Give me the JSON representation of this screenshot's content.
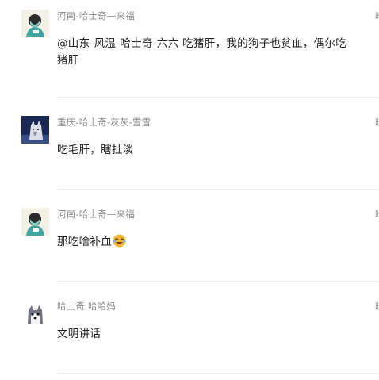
{
  "messages": [
    {
      "sender": "河南-哈士奇—来福",
      "time": "昨",
      "text": "@山东-风温-哈士奇-六六 吃猪肝，我的狗子也贫血，偶尔吃猪肝",
      "avatar_icon": "boy-avatar-icon"
    },
    {
      "sender": "重庆-哈士奇-灰灰-雪雪",
      "time": "昨",
      "text": "吃毛肝，瞎扯淡",
      "avatar_icon": "husky-photo-avatar-icon"
    },
    {
      "sender": "河南-哈士奇—来福",
      "time": "昨",
      "text": "那吃啥补血",
      "emoji": "laughing-tears-emoji",
      "avatar_icon": "boy-avatar-icon"
    },
    {
      "sender": "哈士奇 哈哈妈",
      "time": "昨",
      "text": "文明讲话",
      "avatar_icon": "husky-cartoon-avatar-icon"
    }
  ],
  "colors": {
    "name": "#8a8a8a",
    "text": "#1f1f1f",
    "divider": "#ececec"
  }
}
